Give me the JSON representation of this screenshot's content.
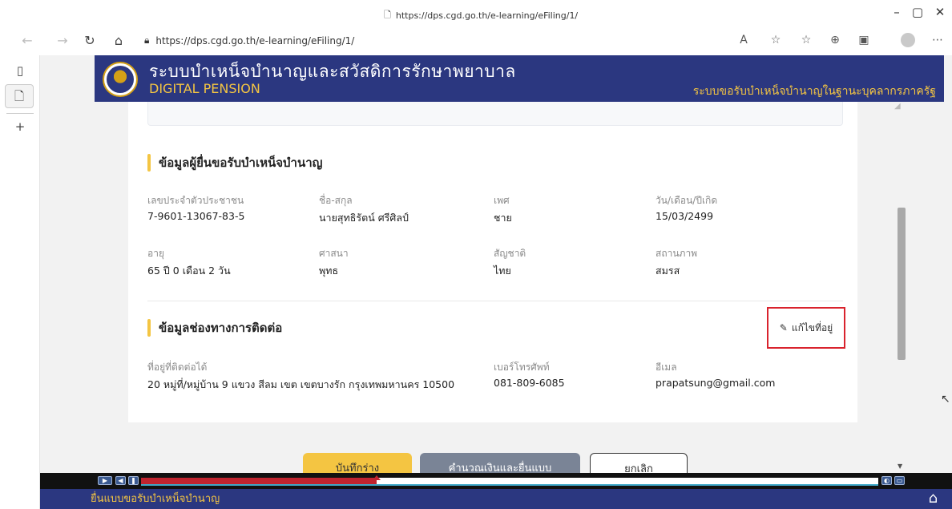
{
  "browser": {
    "window_title": "https://dps.cgd.go.th/e-learning/eFiling/1/",
    "url": "https://dps.cgd.go.th/e-learning/eFiling/1/"
  },
  "site": {
    "title": "ระบบบำเหน็จบำนาญและสวัสดิการรักษาพยาบาล",
    "subtitle": "DIGITAL PENSION",
    "right_caption": "ระบบขอรับบำเหน็จบำนาญในฐานะบุคลากรภาครัฐ"
  },
  "applicant": {
    "heading": "ข้อมูลผู้ยื่นขอรับบำเหน็จบำนาญ",
    "fields": [
      {
        "label": "เลขประจำตัวประชาชน",
        "value": "7-9601-13067-83-5"
      },
      {
        "label": "ชื่อ-สกุล",
        "value": "นายสุทธิรัตน์ ศรีศิลป์"
      },
      {
        "label": "เพศ",
        "value": "ชาย"
      },
      {
        "label": "วัน/เดือน/ปีเกิด",
        "value": "15/03/2499"
      },
      {
        "label": "อายุ",
        "value": "65 ปี 0 เดือน 2 วัน"
      },
      {
        "label": "ศาสนา",
        "value": "พุทธ"
      },
      {
        "label": "สัญชาติ",
        "value": "ไทย"
      },
      {
        "label": "สถานภาพ",
        "value": "สมรส"
      }
    ]
  },
  "contact": {
    "heading": "ข้อมูลช่องทางการติดต่อ",
    "edit_label": "แก้ไขที่อยู่",
    "fields": [
      {
        "label": "ที่อยู่ที่ติดต่อได้",
        "value": "20 หมู่ที่/หมู่บ้าน 9 แขวง สีลม เขต เขตบางรัก กรุงเทพมหานคร 10500"
      },
      {
        "label": "เบอร์โทรศัพท์",
        "value": "081-809-6085"
      },
      {
        "label": "อีเมล",
        "value": "prapatsung@gmail.com"
      }
    ]
  },
  "actions": {
    "save_draft": "บันทึกร่าง",
    "calculate": "คำนวณเงินและยื่นแบบ",
    "cancel": "ยกเลิก"
  },
  "player": {
    "progress": 0.32
  },
  "footer": {
    "caption": "ยื่นแบบขอรับบำเหน็จบำนาญ"
  },
  "colors": {
    "brand_navy": "#2b3780",
    "accent_yellow": "#f4c542",
    "highlight_red": "#d9232d"
  }
}
